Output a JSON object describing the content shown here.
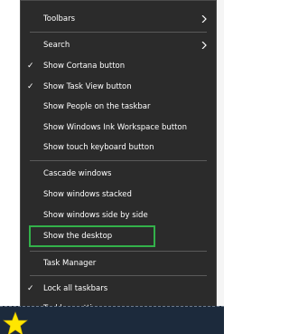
{
  "menu": {
    "items": [
      {
        "label": "Toolbars",
        "checked": false,
        "submenu": true
      },
      {
        "label": "Search",
        "checked": false,
        "submenu": true
      },
      {
        "label": "Show Cortana button",
        "checked": true,
        "submenu": false
      },
      {
        "label": "Show Task View button",
        "checked": true,
        "submenu": false
      },
      {
        "label": "Show People on the taskbar",
        "checked": false,
        "submenu": false
      },
      {
        "label": "Show Windows Ink Workspace button",
        "checked": false,
        "submenu": false
      },
      {
        "label": "Show touch keyboard button",
        "checked": false,
        "submenu": false
      },
      {
        "label": "Cascade windows",
        "checked": false,
        "submenu": false
      },
      {
        "label": "Show windows stacked",
        "checked": false,
        "submenu": false
      },
      {
        "label": "Show windows side by side",
        "checked": false,
        "submenu": false
      },
      {
        "label": "Show the desktop",
        "checked": false,
        "submenu": false,
        "highlighted": true
      },
      {
        "label": "Task Manager",
        "checked": false,
        "submenu": false
      },
      {
        "label": "Lock all taskbars",
        "checked": true,
        "submenu": false
      },
      {
        "label": "Taskbar settings",
        "checked": false,
        "submenu": false,
        "icon": "gear-icon"
      }
    ],
    "check_glyph": "✓"
  },
  "colors": {
    "menu_bg": "#2b2b2b",
    "text": "#ffffff",
    "highlight_border": "#33b14a",
    "star_fill": "#ffe600"
  }
}
